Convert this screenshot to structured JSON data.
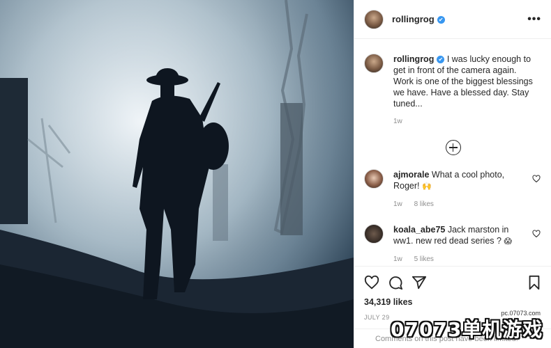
{
  "post": {
    "username": "rollingrog",
    "verified_mark": "✔",
    "more_icon": "more-horizontal-icon"
  },
  "caption": {
    "username": "rollingrog",
    "text": "I was lucky enough to get in front of the camera again. Work is one of the biggest blessings we have. Have a blessed day. Stay tuned...",
    "time": "1w"
  },
  "comments": [
    {
      "username": "ajmorale",
      "text": "What a cool photo, Roger!",
      "emoji": "🙌",
      "time": "1w",
      "likes": "8 likes"
    },
    {
      "username": "koala_abe75",
      "text": "Jack marston in ww1. new red dead series ?",
      "emoji": "😱",
      "time": "1w",
      "likes": "5 likes"
    }
  ],
  "actions": {
    "icons": [
      "heart-icon",
      "comment-icon",
      "share-icon",
      "bookmark-icon"
    ],
    "likes": "34,319 likes",
    "date": "JULY 29"
  },
  "footer": {
    "text": "Comments on this post have been limited."
  },
  "watermark": {
    "site": "pc.07073.com",
    "brand": "07073单机游戏"
  },
  "colors": {
    "verified": "#3897f0",
    "text": "#262626",
    "muted": "#8e8e8e"
  }
}
